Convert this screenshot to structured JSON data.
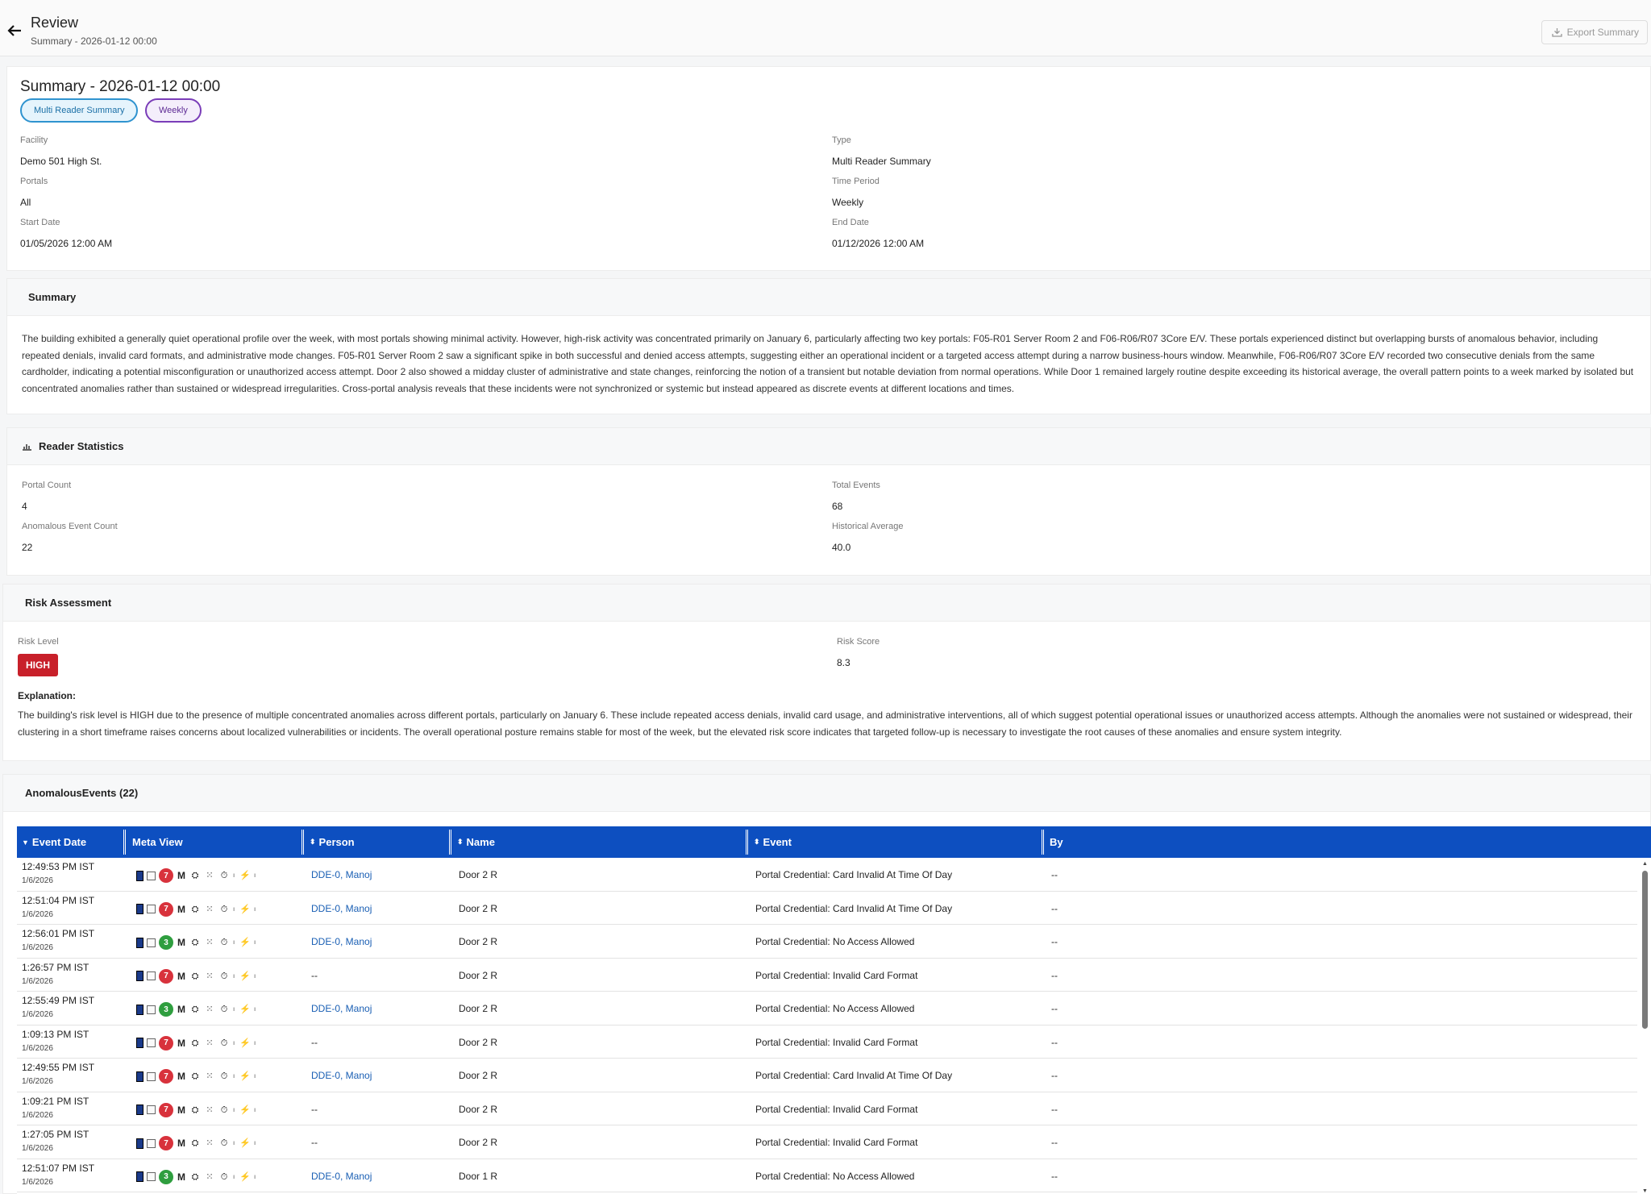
{
  "header": {
    "title": "Review",
    "subtitle": "Summary - 2026-01-12 00:00",
    "export_label": "Export Summary"
  },
  "summary_card": {
    "title": "Summary - 2026-01-12 00:00",
    "chips": [
      "Multi Reader Summary",
      "Weekly"
    ],
    "fields": [
      {
        "label": "Facility",
        "value": "Demo 501 High St."
      },
      {
        "label": "Type",
        "value": "Multi Reader Summary"
      },
      {
        "label": "Portals",
        "value": "All"
      },
      {
        "label": "Time Period",
        "value": "Weekly"
      },
      {
        "label": "Start Date",
        "value": "01/05/2026 12:00 AM"
      },
      {
        "label": "End Date",
        "value": "01/12/2026 12:00 AM"
      }
    ]
  },
  "summary_section": {
    "heading": "Summary",
    "text": "The building exhibited a generally quiet operational profile over the week, with most portals showing minimal activity. However, high-risk activity was concentrated primarily on January 6, particularly affecting two key portals: F05-R01 Server Room 2 and F06-R06/R07 3Core E/V. These portals experienced distinct but overlapping bursts of anomalous behavior, including repeated denials, invalid card formats, and administrative mode changes. F05-R01 Server Room 2 saw a significant spike in both successful and denied access attempts, suggesting either an operational incident or a targeted access attempt during a narrow business-hours window. Meanwhile, F06-R06/R07 3Core E/V recorded two consecutive denials from the same cardholder, indicating a potential misconfiguration or unauthorized access attempt. Door 2 also showed a midday cluster of administrative and state changes, reinforcing the notion of a transient but notable deviation from normal operations. While Door 1 remained largely routine despite exceeding its historical average, the overall pattern points to a week marked by isolated but concentrated anomalies rather than sustained or widespread irregularities. Cross-portal analysis reveals that these incidents were not synchronized or systemic but instead appeared as discrete events at different locations and times."
  },
  "reader_stats": {
    "heading": "Reader Statistics",
    "fields": [
      {
        "label": "Portal Count",
        "value": "4"
      },
      {
        "label": "Total Events",
        "value": "68"
      },
      {
        "label": "Anomalous Event Count",
        "value": "22"
      },
      {
        "label": "Historical Average",
        "value": "40.0"
      }
    ]
  },
  "risk": {
    "heading": "Risk Assessment",
    "level_label": "Risk Level",
    "level": "HIGH",
    "level_color": "#c8202a",
    "score_label": "Risk Score",
    "score": "8.3",
    "explanation_label": "Explanation:",
    "explanation": "The building's risk level is HIGH due to the presence of multiple concentrated anomalies across different portals, particularly on January 6. These include repeated access denials, invalid card usage, and administrative interventions, all of which suggest potential operational issues or unauthorized access attempts. Although the anomalies were not sustained or widespread, their clustering in a short timeframe raises concerns about localized vulnerabilities or incidents. The overall operational posture remains stable for most of the week, but the elevated risk score indicates that targeted follow-up is necessary to investigate the root causes of these anomalies and ensure system integrity."
  },
  "events": {
    "heading": "AnomalousEvents (22)",
    "header_color": "#0d4fc0",
    "columns": [
      "Event Date",
      "Meta View",
      "Person",
      "Name",
      "Event",
      "By"
    ],
    "rows": [
      {
        "time": "12:49:53 PM IST",
        "date": "1/6/2026",
        "count": "7",
        "level": "red",
        "person": "DDE-0, Manoj",
        "name": "Door 2 R",
        "event": "Portal Credential: Card Invalid At Time Of Day",
        "by": "--"
      },
      {
        "time": "12:51:04 PM IST",
        "date": "1/6/2026",
        "count": "7",
        "level": "red",
        "person": "DDE-0, Manoj",
        "name": "Door 2 R",
        "event": "Portal Credential: Card Invalid At Time Of Day",
        "by": "--"
      },
      {
        "time": "12:56:01 PM IST",
        "date": "1/6/2026",
        "count": "3",
        "level": "green",
        "person": "DDE-0, Manoj",
        "name": "Door 2 R",
        "event": "Portal Credential: No Access Allowed",
        "by": "--"
      },
      {
        "time": "1:26:57 PM IST",
        "date": "1/6/2026",
        "count": "7",
        "level": "red",
        "person": "--",
        "name": "Door 2 R",
        "event": "Portal Credential: Invalid Card Format",
        "by": "--"
      },
      {
        "time": "12:55:49 PM IST",
        "date": "1/6/2026",
        "count": "3",
        "level": "green",
        "person": "DDE-0, Manoj",
        "name": "Door 2 R",
        "event": "Portal Credential: No Access Allowed",
        "by": "--"
      },
      {
        "time": "1:09:13 PM IST",
        "date": "1/6/2026",
        "count": "7",
        "level": "red",
        "person": "--",
        "name": "Door 2 R",
        "event": "Portal Credential: Invalid Card Format",
        "by": "--"
      },
      {
        "time": "12:49:55 PM IST",
        "date": "1/6/2026",
        "count": "7",
        "level": "red",
        "person": "DDE-0, Manoj",
        "name": "Door 2 R",
        "event": "Portal Credential: Card Invalid At Time Of Day",
        "by": "--"
      },
      {
        "time": "1:09:21 PM IST",
        "date": "1/6/2026",
        "count": "7",
        "level": "red",
        "person": "--",
        "name": "Door 2 R",
        "event": "Portal Credential: Invalid Card Format",
        "by": "--"
      },
      {
        "time": "1:27:05 PM IST",
        "date": "1/6/2026",
        "count": "7",
        "level": "red",
        "person": "--",
        "name": "Door 2 R",
        "event": "Portal Credential: Invalid Card Format",
        "by": "--"
      },
      {
        "time": "12:51:07 PM IST",
        "date": "1/6/2026",
        "count": "3",
        "level": "green",
        "person": "DDE-0, Manoj",
        "name": "Door 1 R",
        "event": "Portal Credential: No Access Allowed",
        "by": "--"
      }
    ]
  }
}
